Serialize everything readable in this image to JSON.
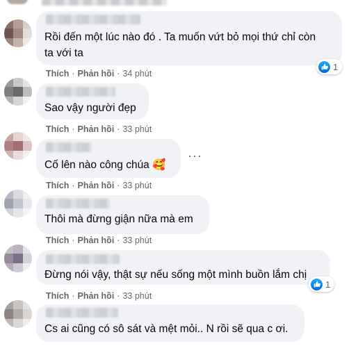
{
  "ui": {
    "like_label": "Thích",
    "reply_label": "Phản hồi",
    "separator": "·",
    "more_label": "···"
  },
  "comments": [
    {
      "text_lines": [
        "Rồi đến một lúc nào đó . Ta muốn vứt bỏ mọi thứ chỉ còn",
        "ta với ta"
      ],
      "time": "34 phút",
      "reaction_count": "1"
    },
    {
      "text_lines": [
        "Sao vậy người đẹp"
      ],
      "time": "33 phút"
    },
    {
      "text_lines": [
        "Cố lên nào công chúa 🥰"
      ],
      "time": "33 phút"
    },
    {
      "text_lines": [
        "Thôi mà đừng giận nữa mà em"
      ],
      "time": "33 phút"
    },
    {
      "text_lines": [
        "Đừng nói vậy, thật sự nếu sống một mình buồn lắm chị"
      ],
      "time": "33 phút",
      "reaction_count": "1"
    },
    {
      "text_lines": [
        "Cs ai cũng có sô sát và mệt mỏi.. N rồi sẽ qua c ơi."
      ]
    }
  ],
  "colors": {
    "bubble": "#f0f2f5",
    "text": "#050505",
    "meta": "#65676b",
    "like_blue": "#1877f2"
  }
}
